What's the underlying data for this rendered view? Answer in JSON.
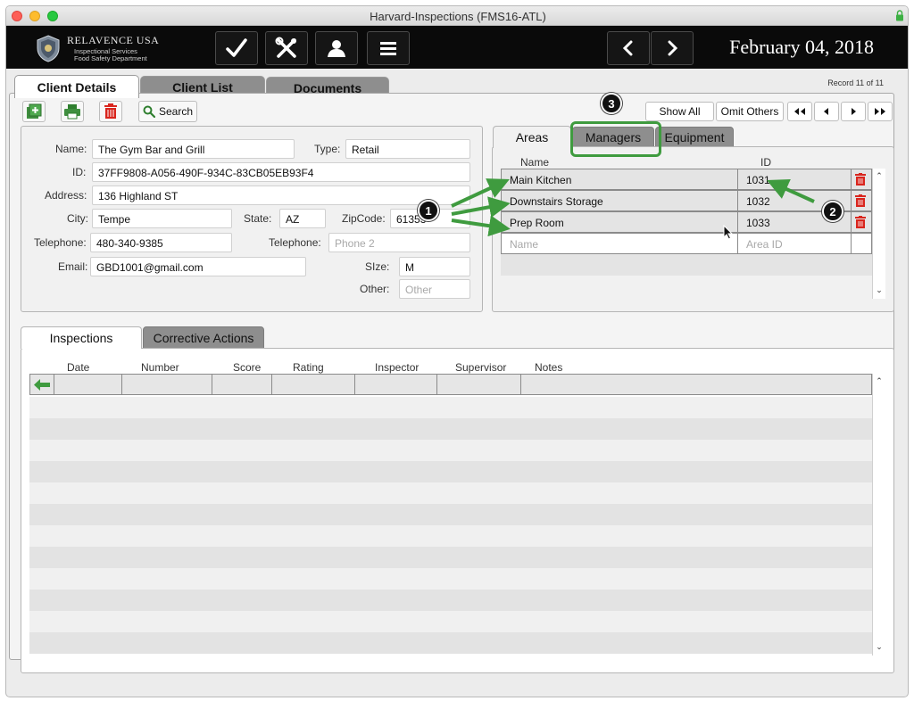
{
  "window": {
    "title": "Harvard-Inspections (FMS16-ATL)"
  },
  "logo": {
    "title": "RELAVENCE USA",
    "line1": "Inspectional Services",
    "line2": "Food Safety Department"
  },
  "toolbar": {
    "buttons": [
      "checkmark-icon",
      "tools-icon",
      "user-icon",
      "menu-icon"
    ],
    "prev": "chevron-left-icon",
    "next": "chevron-right-icon",
    "date": "February 04, 2018"
  },
  "main_tabs": [
    "Client Details",
    "Client List",
    "Documents"
  ],
  "record_count": "Record 11 of 11",
  "actions": {
    "search": "Search"
  },
  "nav": {
    "show_all": "Show All",
    "omit_others": "Omit Others"
  },
  "client": {
    "name_label": "Name:",
    "name": "The Gym Bar and Grill",
    "type_label": "Type:",
    "type": "Retail",
    "id_label": "ID:",
    "id": "37FF9808-A056-490F-934C-83CB05EB93F4",
    "address_label": "Address:",
    "address": "136 Highland ST",
    "city_label": "City:",
    "city": "Tempe",
    "state_label": "State:",
    "state": "AZ",
    "zip_label": "ZipCode:",
    "zip": "61353",
    "tel_label": "Telephone:",
    "tel": "480-340-9385",
    "tel2_label": "Telephone:",
    "tel2_placeholder": "Phone 2",
    "email_label": "Email:",
    "email": "GBD1001@gmail.com",
    "size_label": "SIze:",
    "size": "M",
    "other_label": "Other:",
    "other_placeholder": "Other"
  },
  "area_tabs": [
    "Areas",
    "Managers",
    "Equipment"
  ],
  "areas": {
    "col_name": "Name",
    "col_id": "ID",
    "rows": [
      {
        "name": "Main Kitchen",
        "id": "1031"
      },
      {
        "name": "Downstairs Storage",
        "id": "1032"
      },
      {
        "name": "Prep Room",
        "id": "1033"
      }
    ],
    "new_name_placeholder": "Name",
    "new_id_placeholder": "Area ID"
  },
  "inspection_tabs": [
    "Inspections",
    "Corrective Actions"
  ],
  "inspections": {
    "columns": [
      "Date",
      "Number",
      "Score",
      "Rating",
      "Inspector",
      "Supervisor",
      "Notes"
    ]
  },
  "annotations": [
    "1",
    "2",
    "3"
  ],
  "colors": {
    "accent_green": "#3f9b3f",
    "delete_red": "#d9251d",
    "appbar": "#0a0a0a"
  }
}
